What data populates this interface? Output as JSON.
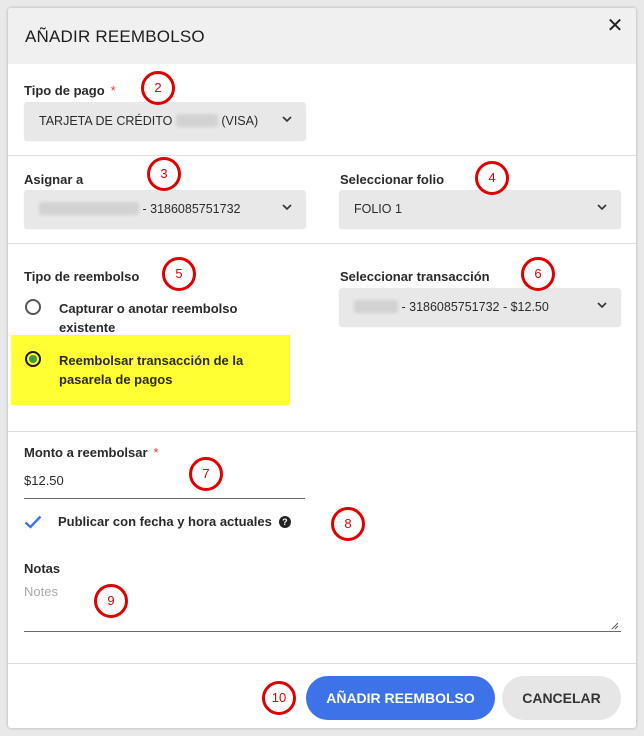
{
  "dialog": {
    "title": "AÑADIR REEMBOLSO",
    "close_glyph": "✕"
  },
  "tipo_pago": {
    "label": "Tipo de pago",
    "required_mark": "*",
    "value_prefix": "TARJETA DE CRÉDITO",
    "value_suffix": "(VISA)"
  },
  "asignar": {
    "label": "Asignar a",
    "value_suffix": "- 3186085751732"
  },
  "folio": {
    "label": "Seleccionar folio",
    "value": "FOLIO 1"
  },
  "tipo_reembolso": {
    "label": "Tipo de reembolso",
    "options": [
      {
        "label": "Capturar o anotar reembolso existente",
        "checked": false
      },
      {
        "label": "Reembolsar transacción de la pasarela de pagos",
        "checked": true
      }
    ]
  },
  "transaccion": {
    "label": "Seleccionar transacción",
    "value_suffix": "- 3186085751732 - $12.50"
  },
  "monto": {
    "label": "Monto a reembolsar",
    "required_mark": "*",
    "value": "$12.50"
  },
  "publicar": {
    "label": "Publicar con fecha y hora actuales",
    "checked": true,
    "help_glyph": "?"
  },
  "notas": {
    "label": "Notas",
    "placeholder": "Notes"
  },
  "buttons": {
    "submit": "AÑADIR REEMBOLSO",
    "cancel": "CANCELAR"
  },
  "callouts": [
    "2",
    "3",
    "4",
    "5",
    "6",
    "7",
    "8",
    "9",
    "10"
  ],
  "colors": {
    "primary": "#3d72e8",
    "highlight": "#ffff33",
    "callout": "#e00000",
    "radio_checked": "#3f9a44",
    "check": "#3d72e8",
    "required": "#e23b3b"
  }
}
